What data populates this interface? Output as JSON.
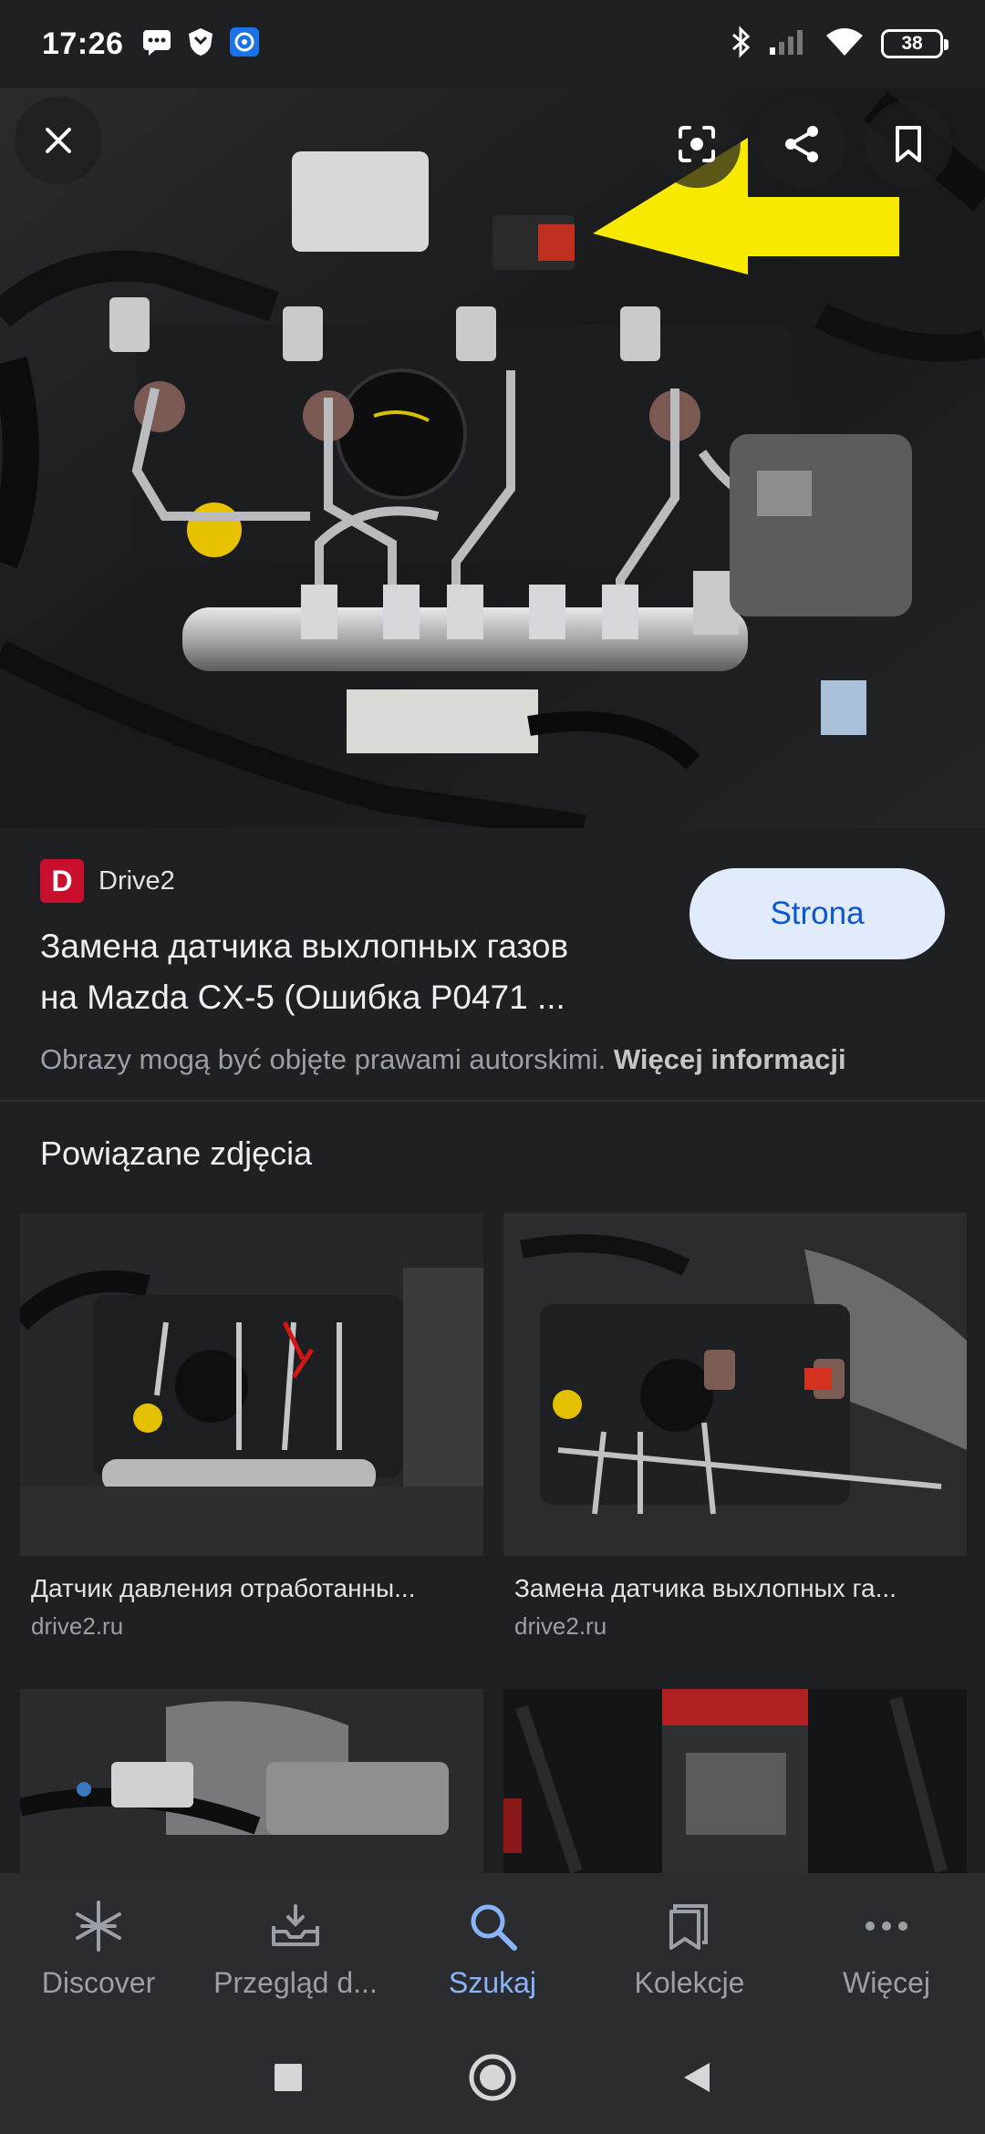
{
  "status_bar": {
    "time": "17:26",
    "battery": "38",
    "left_icons": [
      "message-icon",
      "shield-app-icon",
      "blue-app-icon"
    ],
    "right_icons": [
      "bluetooth-icon",
      "signal-icon",
      "wifi-icon",
      "battery-icon"
    ]
  },
  "hero": {
    "image_kind": "engine-photo",
    "actions": [
      "close-icon",
      "lens-icon",
      "share-icon",
      "bookmark-icon"
    ]
  },
  "source": {
    "logo_letter": "D",
    "site_name": "Drive2",
    "title_line1": "Замена датчика выхлопных газов",
    "title_line2": "на Mazda CX-5 (Ошибка P0471 ...",
    "visit_button": "Strona",
    "copyright_text": "Obrazy mogą być objęte prawami autorskimi.",
    "more_info_link": "Więcej informacji"
  },
  "related": {
    "heading": "Powiązane zdjęcia",
    "items": [
      {
        "caption": "Датчик давления отработанны...",
        "domain": "drive2.ru"
      },
      {
        "caption": "Замена датчика выхлопных га...",
        "domain": "drive2.ru"
      },
      {
        "caption": "",
        "domain": ""
      },
      {
        "caption": "",
        "domain": ""
      }
    ]
  },
  "bottom_nav": {
    "items": [
      {
        "label": "Discover",
        "icon": "asterisk-icon",
        "active": false
      },
      {
        "label": "Przegląd d...",
        "icon": "inbox-icon",
        "active": false
      },
      {
        "label": "Szukaj",
        "icon": "search-icon",
        "active": true
      },
      {
        "label": "Kolekcje",
        "icon": "collections-icon",
        "active": false
      },
      {
        "label": "Więcej",
        "icon": "more-icon",
        "active": false
      }
    ]
  },
  "colors": {
    "background": "#1f2023",
    "accent": "#8ab4f8",
    "button_bg": "#e2ebfb",
    "button_text": "#0b57d0",
    "site_logo": "#c8102e",
    "arrow": "#f7e900"
  }
}
